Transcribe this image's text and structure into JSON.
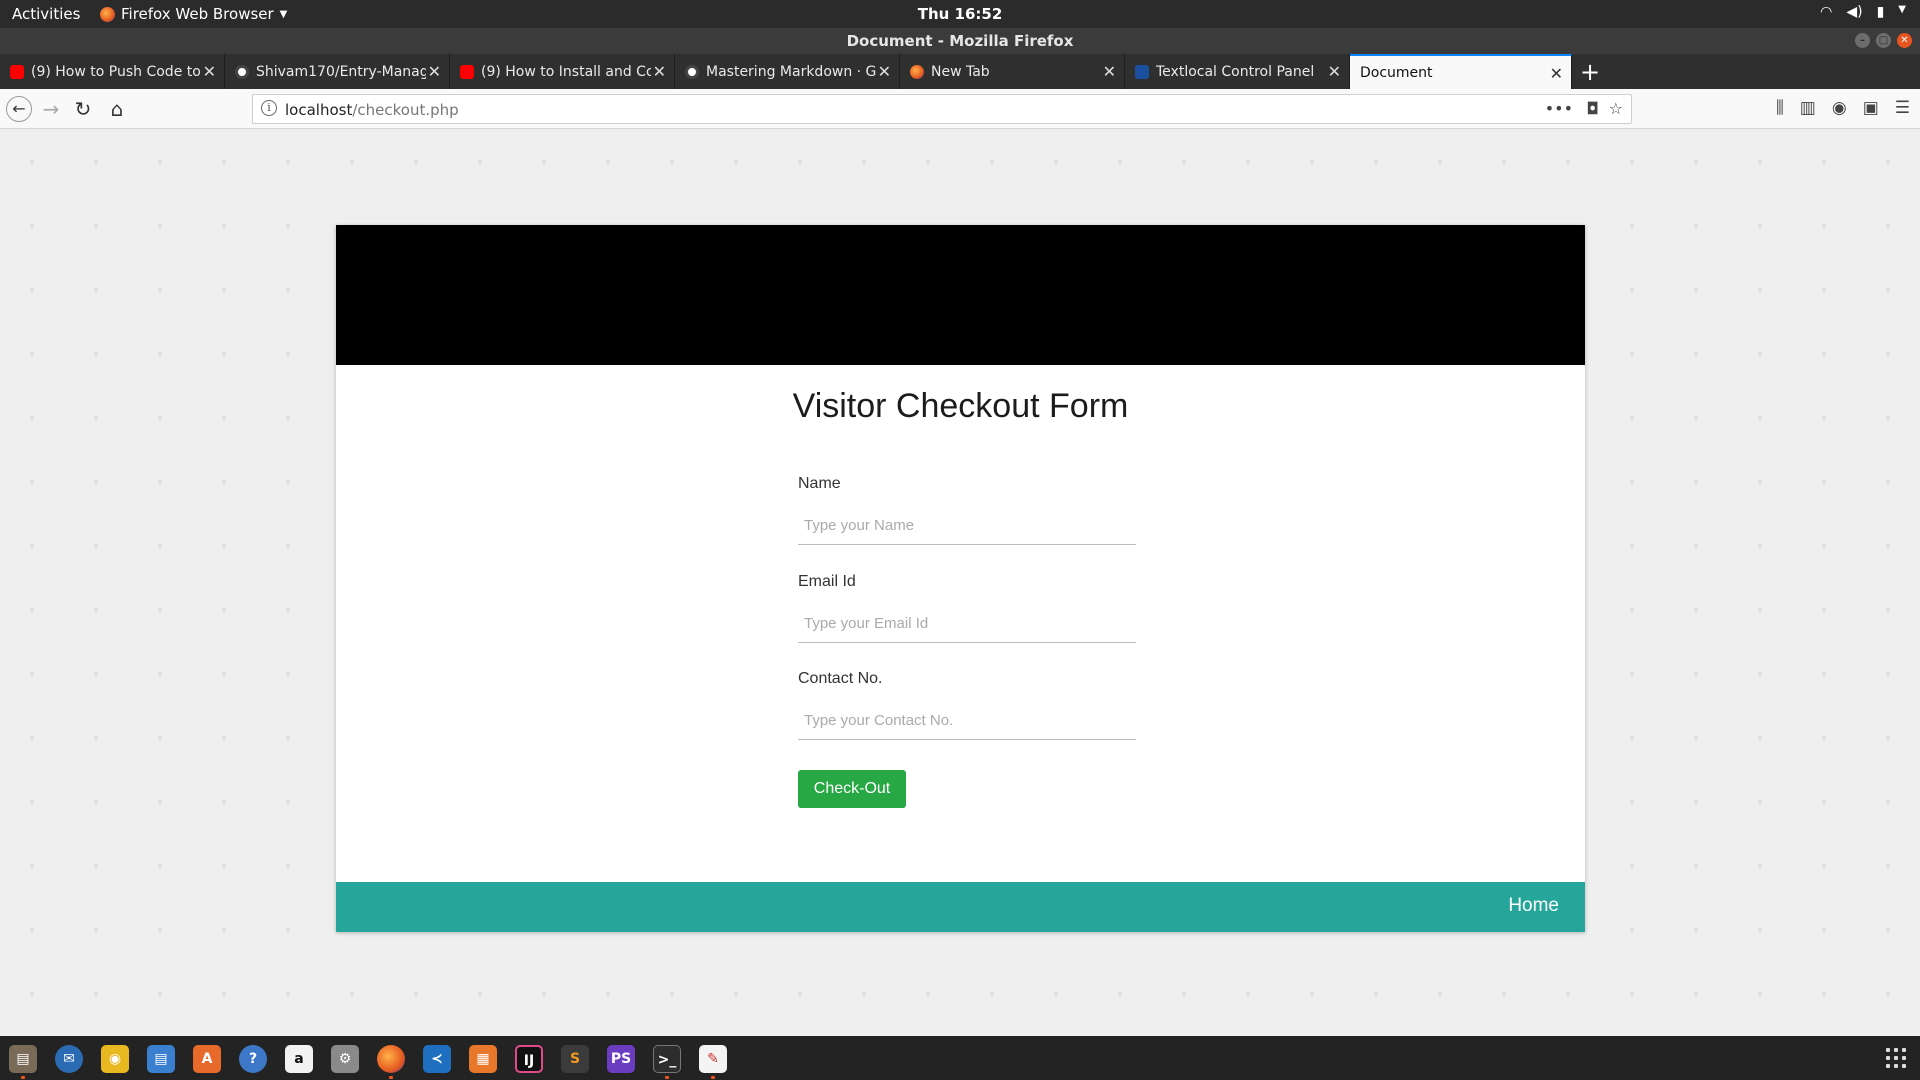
{
  "topbar": {
    "activities": "Activities",
    "app_name": "Firefox Web Browser",
    "clock": "Thu 16:52"
  },
  "window": {
    "title": "Document - Mozilla Firefox"
  },
  "tabs": [
    {
      "label": "(9) How to Push Code to",
      "favicon": "youtube-icon"
    },
    {
      "label": "Shivam170/Entry-Manag",
      "favicon": "github-icon"
    },
    {
      "label": "(9) How to Install and Co",
      "favicon": "youtube-icon"
    },
    {
      "label": "Mastering Markdown · G",
      "favicon": "github-icon"
    },
    {
      "label": "New Tab",
      "favicon": "firefox-icon"
    },
    {
      "label": "Textlocal Control Panel",
      "favicon": "textlocal-icon"
    },
    {
      "label": "Document",
      "favicon": "none",
      "active": true
    }
  ],
  "navbar": {
    "url_host": "localhost",
    "url_path": "/checkout.php"
  },
  "form": {
    "title": "Visitor Checkout Form",
    "fields": [
      {
        "label": "Name",
        "placeholder": "Type your Name",
        "value": ""
      },
      {
        "label": "Email Id",
        "placeholder": "Type your Email Id",
        "value": ""
      },
      {
        "label": "Contact No.",
        "placeholder": "Type your Contact No.",
        "value": ""
      }
    ],
    "submit_label": "Check-Out"
  },
  "footer": {
    "home_label": "Home"
  },
  "colors": {
    "banner": "#000000",
    "footer": "#26a69a",
    "button": "#28a745",
    "accent": "#e95420"
  },
  "dock": {
    "apps": [
      "files-icon",
      "thunderbird-icon",
      "rhythmbox-icon",
      "libreoffice-writer-icon",
      "software-center-icon",
      "help-icon",
      "amazon-icon",
      "settings-icon",
      "firefox-icon",
      "vscode-icon",
      "sublime-merge-icon",
      "intellij-icon",
      "sublime-text-icon",
      "phpstorm-icon",
      "terminal-icon",
      "text-editor-icon"
    ]
  }
}
